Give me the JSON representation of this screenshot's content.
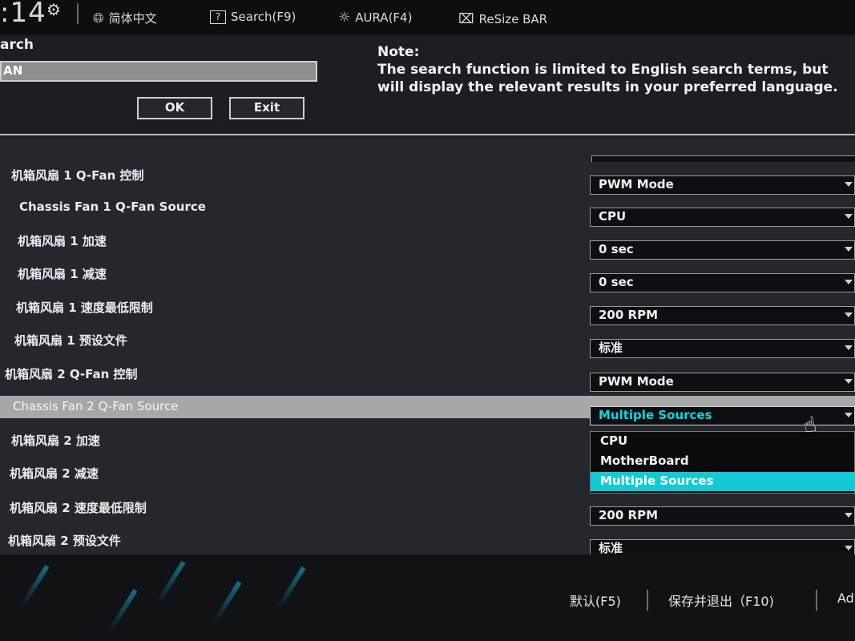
{
  "topbar": {
    "time_fragment": ":14",
    "language_label": "简体中文",
    "search_label": "Search(F9)",
    "aura_label": "AURA(F4)",
    "resize_label": "ReSize BAR"
  },
  "search": {
    "title": "arch",
    "input_value": "AN",
    "ok_label": "OK",
    "exit_label": "Exit",
    "note_title": "Note:",
    "note_text": "The search function is limited to English search terms, but will display the relevant results in your preferred language."
  },
  "settings": {
    "rows": [
      {
        "label": "机箱风扇 1 Q-Fan 控制",
        "value": "PWM Mode"
      },
      {
        "label": "Chassis Fan 1 Q-Fan Source",
        "value": "CPU"
      },
      {
        "label": "机箱风扇 1 加速",
        "value": "0 sec"
      },
      {
        "label": "机箱风扇 1 减速",
        "value": "0 sec"
      },
      {
        "label": "机箱风扇 1 速度最低限制",
        "value": "200 RPM"
      },
      {
        "label": "机箱风扇 1 预设文件",
        "value": "标准"
      },
      {
        "label": "机箱风扇 2 Q-Fan 控制",
        "value": "PWM Mode"
      },
      {
        "label": "Chassis Fan 2 Q-Fan Source",
        "value": "Multiple Sources"
      },
      {
        "label": "机箱风扇 2 加速",
        "value": ""
      },
      {
        "label": "机箱风扇 2 减速",
        "value": ""
      },
      {
        "label": "机箱风扇 2 速度最低限制",
        "value": "200 RPM"
      },
      {
        "label": "机箱风扇 2 预设文件",
        "value": "标准"
      }
    ],
    "dropdown_options": [
      "CPU",
      "MotherBoard",
      "Multiple Sources"
    ],
    "dropdown_selected": "Multiple Sources"
  },
  "bottombar": {
    "default_label": "默认(F5)",
    "save_exit_label": "保存并退出（F10)",
    "advanced_fragment": "Ad"
  },
  "colors": {
    "accent": "#12c9d4",
    "highlight_row": "#a7a7a7",
    "background": "#24272c"
  }
}
